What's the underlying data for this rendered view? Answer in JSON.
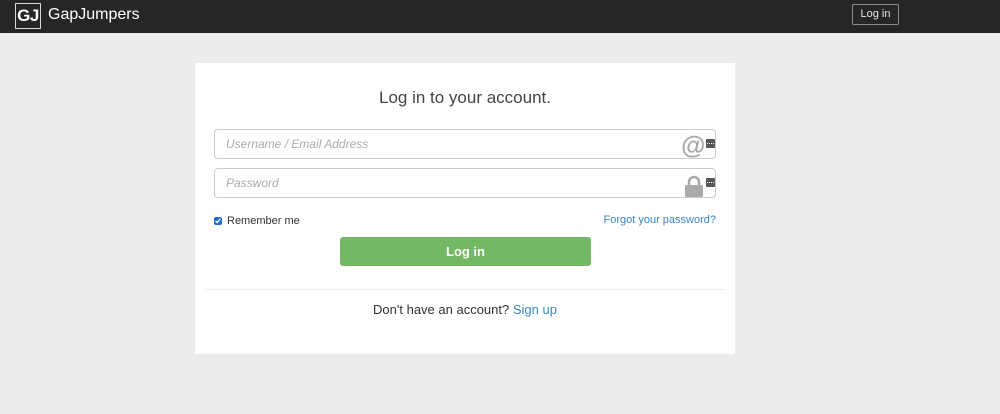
{
  "navbar": {
    "logo_text": "GJ",
    "brand": "GapJumpers",
    "login_label": "Log in"
  },
  "card": {
    "title": "Log in to your account.",
    "username": {
      "value": "",
      "placeholder": "Username / Email Address",
      "icon": "at-icon"
    },
    "password": {
      "value": "",
      "placeholder": "Password",
      "icon": "lock-icon"
    },
    "remember_label": "Remember me",
    "remember_checked": true,
    "forgot_link": "Forgot your password?",
    "submit_label": "Log in",
    "signup_prompt": "Don't have an account?",
    "signup_link": "Sign up"
  },
  "colors": {
    "navbar_bg": "#262626",
    "page_bg": "#ececec",
    "submit_bg": "#74b866",
    "link": "#3a86c8"
  }
}
